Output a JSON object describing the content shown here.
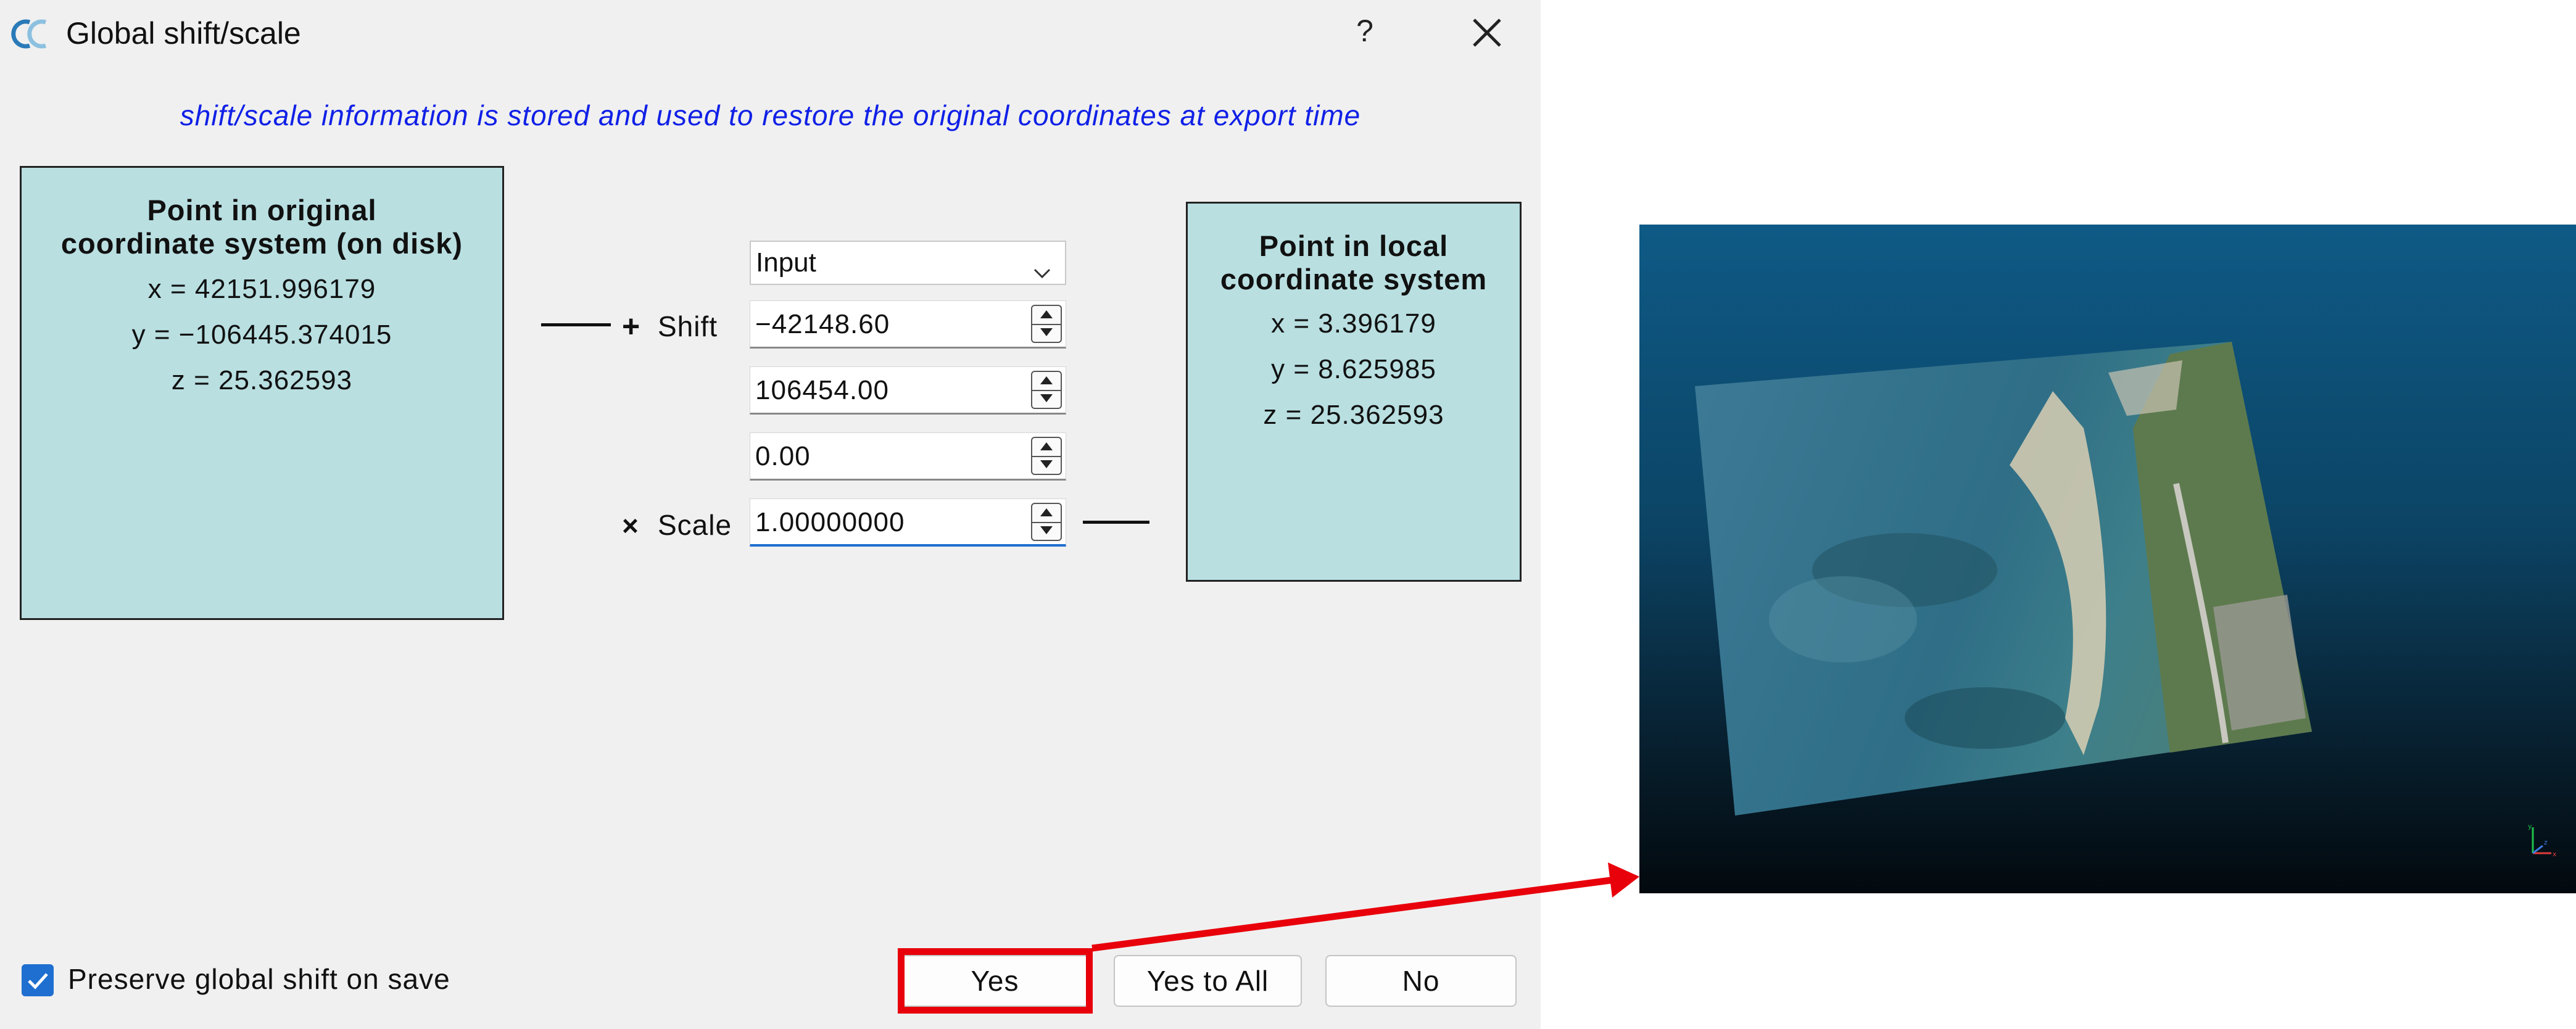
{
  "dialog": {
    "title": "Global shift/scale",
    "help_label": "?",
    "info_text": "shift/scale information is stored and used to restore the original coordinates at export time",
    "original_point": {
      "heading_line1": "Point in original",
      "heading_line2": "coordinate system (on disk)",
      "x": "x = 42151.996179",
      "y": "y = −106445.374015",
      "z": "z = 25.362593"
    },
    "local_point": {
      "heading_line1": "Point in local",
      "heading_line2": "coordinate system",
      "x": "x = 3.396179",
      "y": "y = 8.625985",
      "z": "z = 25.362593"
    },
    "mode_select": {
      "value": "Input"
    },
    "shift": {
      "label": "Shift",
      "symbol": "+",
      "x": "−42148.60",
      "y": "106454.00",
      "z": "0.00"
    },
    "scale": {
      "label": "Scale",
      "symbol": "×",
      "value": "1.00000000"
    },
    "preserve_checkbox": {
      "label": "Preserve global shift on save",
      "checked": true
    },
    "buttons": {
      "yes": "Yes",
      "yes_to_all": "Yes to All",
      "no": "No"
    }
  },
  "colors": {
    "dialog_bg": "#f0f0f0",
    "coord_box_bg": "#b9dfe1",
    "info_text": "#1020e6",
    "highlight": "#e8000b",
    "accent": "#1e6fd0"
  },
  "viewer": {
    "axis_labels": {
      "x": "x",
      "y": "y",
      "z": "z"
    }
  }
}
